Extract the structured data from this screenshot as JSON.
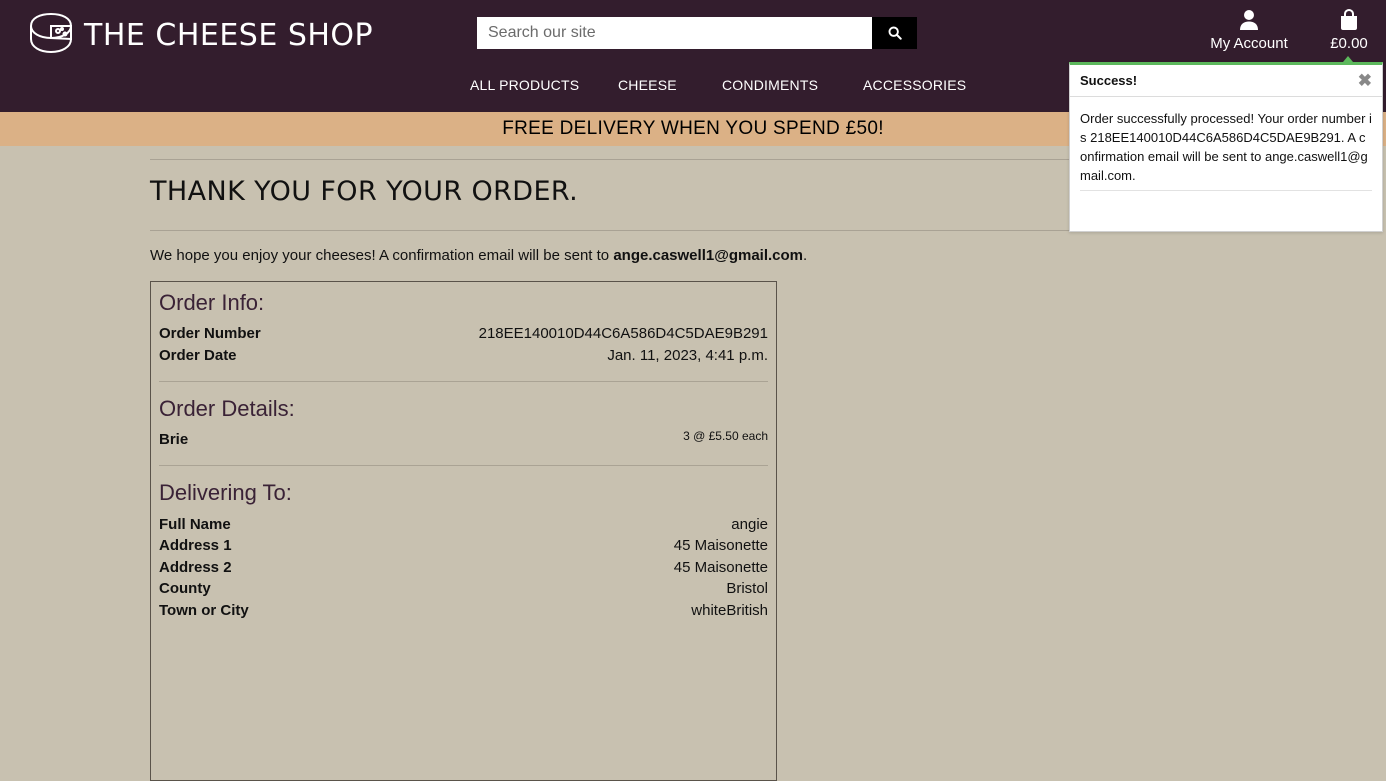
{
  "header": {
    "logo_text": "THE CHEESE SHOP",
    "search_placeholder": "Search our site",
    "account_label": "My Account",
    "bag_total": "£0.00"
  },
  "nav": {
    "items": [
      "ALL PRODUCTS",
      "CHEESE",
      "CONDIMENTS",
      "ACCESSORIES"
    ]
  },
  "banner": {
    "text": "FREE DELIVERY WHEN YOU SPEND £50!"
  },
  "page": {
    "title": "THANK YOU FOR YOUR ORDER.",
    "thanks_prefix": "We hope you enjoy your cheeses! A confirmation email will be sent to ",
    "thanks_email": "ange.caswell1@gmail.com",
    "thanks_suffix": "."
  },
  "order_info": {
    "heading": "Order Info:",
    "number_label": "Order Number",
    "number_value": "218EE140010D44C6A586D4C5DAE9B291",
    "date_label": "Order Date",
    "date_value": "Jan. 11, 2023, 4:41 p.m."
  },
  "order_details": {
    "heading": "Order Details:",
    "items": [
      {
        "name": "Brie",
        "qty_price": "3 @ £5.50 each"
      }
    ]
  },
  "delivery": {
    "heading": "Delivering To:",
    "rows": [
      {
        "label": "Full Name",
        "value": "angie"
      },
      {
        "label": "Address 1",
        "value": "45 Maisonette"
      },
      {
        "label": "Address 2",
        "value": "45 Maisonette"
      },
      {
        "label": "County",
        "value": "Bristol"
      },
      {
        "label": "Town or City",
        "value": "whiteBritish"
      }
    ]
  },
  "toast": {
    "title": "Success!",
    "close": "✖",
    "message": "Order successfully processed! Your order number is 218EE140010D44C6A586D4C5DAE9B291. A confirmation email will be sent to ange.caswell1@gmail.com."
  },
  "colors": {
    "header_bg": "#331d2d",
    "banner_bg": "#dbb186",
    "page_bg": "#c8c1b0",
    "heading_color": "#3a2236",
    "toast_accent": "#5cb85c"
  },
  "icons": {
    "logo": "cheese-wheel-icon",
    "search": "search-icon",
    "account": "user-icon",
    "bag": "shopping-bag-icon",
    "close": "close-icon"
  }
}
